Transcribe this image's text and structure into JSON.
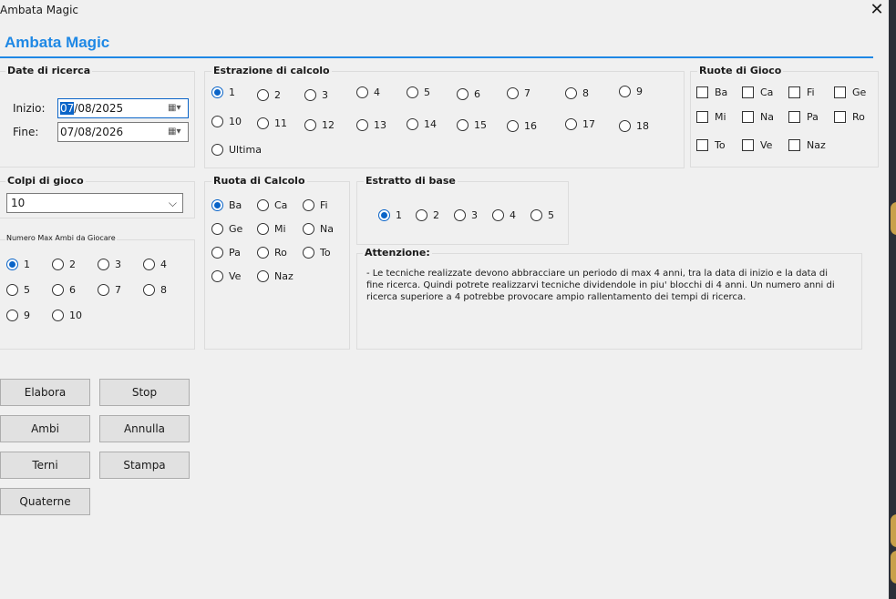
{
  "window": {
    "title": "Ambata Magic",
    "close_glyph": "✕"
  },
  "app": {
    "title": "Ambata Magic",
    "accent": "#1e88e5"
  },
  "date_group": {
    "title": "Date di ricerca",
    "start_label": "Inizio:",
    "start_value_sel": "07",
    "start_value_rest": "/08/2025",
    "end_label": "Fine:",
    "end_value": "07/08/2026"
  },
  "colpi": {
    "title": "Colpi di gioco",
    "value": "10"
  },
  "max_ambi": {
    "title": "Numero Max Ambi da Giocare",
    "options": [
      "1",
      "2",
      "3",
      "4",
      "5",
      "6",
      "7",
      "8",
      "9",
      "10"
    ],
    "selected": "1"
  },
  "estrazione": {
    "title": "Estrazione di calcolo",
    "options": [
      "1",
      "2",
      "3",
      "4",
      "5",
      "6",
      "7",
      "8",
      "9",
      "10",
      "11",
      "12",
      "13",
      "14",
      "15",
      "16",
      "17",
      "18",
      "Ultima"
    ],
    "selected": "1"
  },
  "ruote_gioco": {
    "title": "Ruote di Gioco",
    "options": [
      "Ba",
      "Ca",
      "Fi",
      "Ge",
      "Mi",
      "Na",
      "Pa",
      "Ro",
      "To",
      "Ve",
      "Naz"
    ]
  },
  "ruota_calcolo": {
    "title": "Ruota di Calcolo",
    "options": [
      "Ba",
      "Ca",
      "Fi",
      "Ge",
      "Mi",
      "Na",
      "Pa",
      "Ro",
      "To",
      "Ve",
      "Naz"
    ],
    "selected": "Ba"
  },
  "estratto_base": {
    "title": "Estratto di base",
    "options": [
      "1",
      "2",
      "3",
      "4",
      "5"
    ],
    "selected": "1"
  },
  "attenzione": {
    "title": "Attenzione:",
    "lines": [
      "- Le tecniche realizzate devono abbracciare un periodo di max 4 anni, tra la data di inizio e la data di",
      "fine ricerca. Quindi potrete realizzarvi tecniche dividendole in piu' blocchi di 4 anni. Un numero anni di",
      "ricerca superiore a 4 potrebbe provocare ampio rallentamento dei tempi di ricerca."
    ]
  },
  "buttons": {
    "elabora": "Elabora",
    "stop": "Stop",
    "ambi": "Ambi",
    "annulla": "Annulla",
    "terni": "Terni",
    "stampa": "Stampa",
    "quaterne": "Quaterne"
  }
}
